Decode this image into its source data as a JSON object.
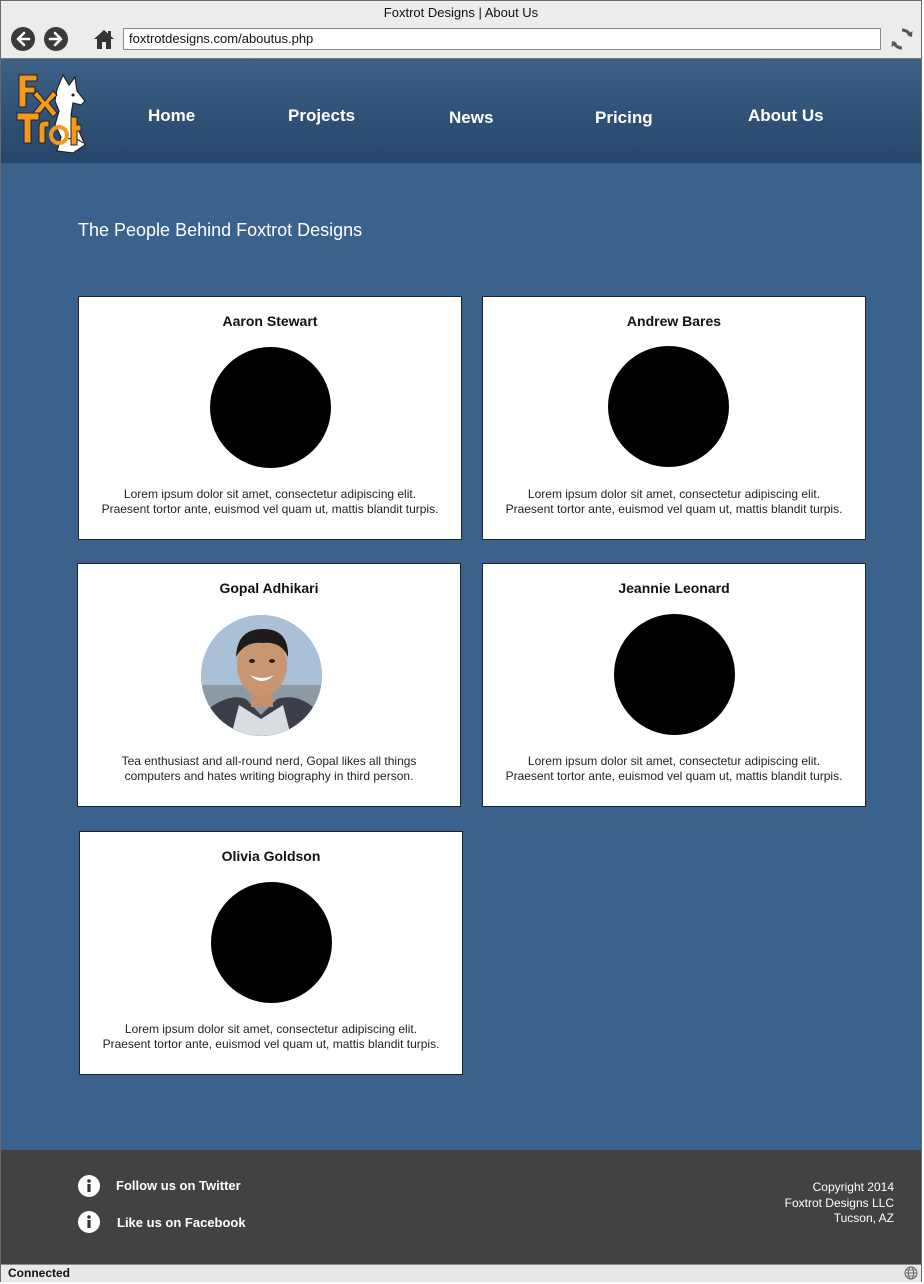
{
  "browser": {
    "window_title": "Foxtrot Designs | About Us",
    "url": "foxtrotdesigns.com/aboutus.php",
    "status": "Connected",
    "icons": [
      "back-icon",
      "forward-icon",
      "home-icon",
      "refresh-icon",
      "globe-icon"
    ]
  },
  "site": {
    "logo_alt": "Fox Trot",
    "nav": [
      "Home",
      "Projects",
      "News",
      "Pricing",
      "About Us"
    ]
  },
  "main": {
    "title": "The People Behind Foxtrot Designs",
    "team": [
      {
        "name": "Aaron Stewart",
        "bio_line1": "Lorem ipsum dolor sit amet, consectetur adipiscing elit.",
        "bio_line2": "Praesent tortor ante, euismod vel quam ut, mattis blandit turpis.",
        "photo": "placeholder"
      },
      {
        "name": "Andrew Bares",
        "bio_line1": "Lorem ipsum dolor sit amet, consectetur adipiscing elit.",
        "bio_line2": "Praesent tortor ante, euismod vel quam ut, mattis blandit turpis.",
        "photo": "placeholder"
      },
      {
        "name": "Gopal Adhikari",
        "bio_line1": "Tea enthusiast and all-round nerd, Gopal likes all things",
        "bio_line2": "computers and hates writing biography in third person.",
        "photo": "portrait"
      },
      {
        "name": "Jeannie Leonard",
        "bio_line1": "Lorem ipsum dolor sit amet, consectetur adipiscing elit.",
        "bio_line2": "Praesent tortor ante, euismod vel quam ut, mattis blandit turpis.",
        "photo": "placeholder"
      },
      {
        "name": "Olivia Goldson",
        "bio_line1": "Lorem ipsum dolor sit amet, consectetur adipiscing elit.",
        "bio_line2": "Praesent tortor ante, euismod vel quam ut, mattis blandit turpis.",
        "photo": "placeholder"
      }
    ]
  },
  "footer": {
    "twitter": "Follow us on Twitter",
    "facebook": "Like us on Facebook",
    "copyright_line1": "Copyright 2014",
    "copyright_line2": "Foxtrot Designs LLC",
    "copyright_line3": "Tucson, AZ"
  },
  "colors": {
    "header": "#2f5179",
    "main_bg": "#3a628c",
    "footer_bg": "#424242",
    "logo_orange": "#f39a1e"
  }
}
